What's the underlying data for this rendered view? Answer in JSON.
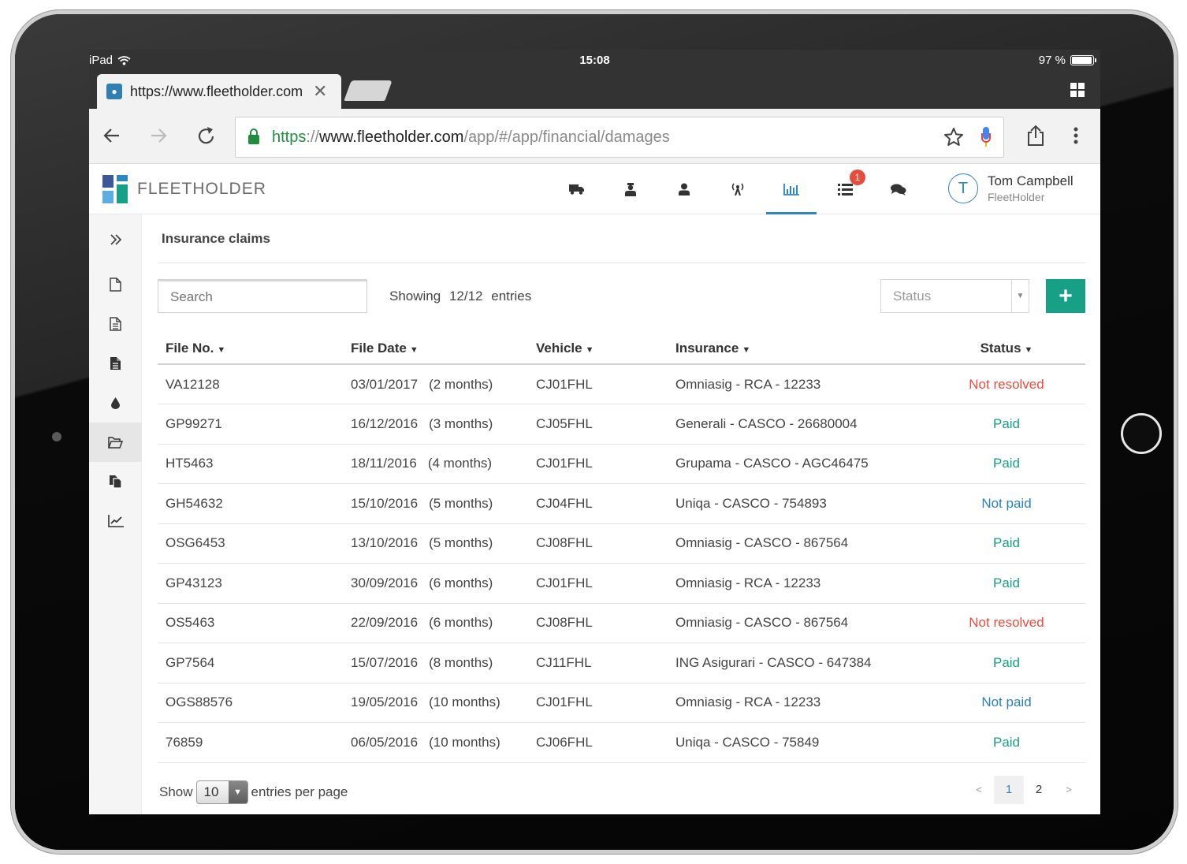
{
  "device": {
    "status": {
      "carrier": "iPad",
      "time": "15:08",
      "battery": "97 %",
      "battery_level": 0.97
    }
  },
  "browser": {
    "tab_title": "https://www.fleetholder.com",
    "url_scheme": "https",
    "url_sep": "://",
    "url_host": "www.fleetholder.com",
    "url_path": "/app/#/app/financial/damages"
  },
  "app": {
    "logo_text": "FLEETHOLDER",
    "logo_colors": [
      "#3b5998",
      "#2e86c1",
      "#5dade2",
      "#16a085"
    ],
    "nav_badge": "1",
    "user": {
      "initial": "T",
      "name": "Tom Campbell",
      "org": "FleetHolder"
    }
  },
  "page": {
    "title": "Insurance claims",
    "search_placeholder": "Search",
    "showing_label": "Showing",
    "showing_count": "12/12",
    "showing_suffix": "entries",
    "status_placeholder": "Status",
    "add_label": "+"
  },
  "table": {
    "headers": [
      "File No.",
      "File Date",
      "Vehicle",
      "Insurance",
      "Status"
    ],
    "rows": [
      {
        "file_no": "VA12128",
        "date": "03/01/2017",
        "age": "(2 months)",
        "vehicle": "CJ01FHL",
        "insurance": "Omniasig - RCA - 12233",
        "status": "Not resolved"
      },
      {
        "file_no": "GP99271",
        "date": "16/12/2016",
        "age": "(3 months)",
        "vehicle": "CJ05FHL",
        "insurance": "Generali - CASCO - 26680004",
        "status": "Paid"
      },
      {
        "file_no": "HT5463",
        "date": "18/11/2016",
        "age": "(4 months)",
        "vehicle": "CJ01FHL",
        "insurance": "Grupama - CASCO - AGC46475",
        "status": "Paid"
      },
      {
        "file_no": "GH54632",
        "date": "15/10/2016",
        "age": "(5 months)",
        "vehicle": "CJ04FHL",
        "insurance": "Uniqa - CASCO - 754893",
        "status": "Not paid"
      },
      {
        "file_no": "OSG6453",
        "date": "13/10/2016",
        "age": "(5 months)",
        "vehicle": "CJ08FHL",
        "insurance": "Omniasig - CASCO - 867564",
        "status": "Paid"
      },
      {
        "file_no": "GP43123",
        "date": "30/09/2016",
        "age": "(6 months)",
        "vehicle": "CJ01FHL",
        "insurance": "Omniasig - RCA - 12233",
        "status": "Paid"
      },
      {
        "file_no": "OS5463",
        "date": "22/09/2016",
        "age": "(6 months)",
        "vehicle": "CJ08FHL",
        "insurance": "Omniasig - CASCO - 867564",
        "status": "Not resolved"
      },
      {
        "file_no": "GP7564",
        "date": "15/07/2016",
        "age": "(8 months)",
        "vehicle": "CJ11FHL",
        "insurance": "ING Asigurari - CASCO - 647384",
        "status": "Paid"
      },
      {
        "file_no": "OGS88576",
        "date": "19/05/2016",
        "age": "(10 months)",
        "vehicle": "CJ01FHL",
        "insurance": "Omniasig - RCA - 12233",
        "status": "Not paid"
      },
      {
        "file_no": "76859",
        "date": "06/05/2016",
        "age": "(10 months)",
        "vehicle": "CJ06FHL",
        "insurance": "Uniqa - CASCO - 75849",
        "status": "Paid"
      }
    ]
  },
  "footer": {
    "show_label": "Show",
    "per_page": "10",
    "per_page_suffix": "entries per page",
    "prev": "<",
    "next": ">",
    "pages": [
      "1",
      "2"
    ]
  },
  "colors": {
    "accent": "#2e86c1",
    "green": "#16a085",
    "red": "#e74c3c",
    "blue": "#2980b9"
  }
}
